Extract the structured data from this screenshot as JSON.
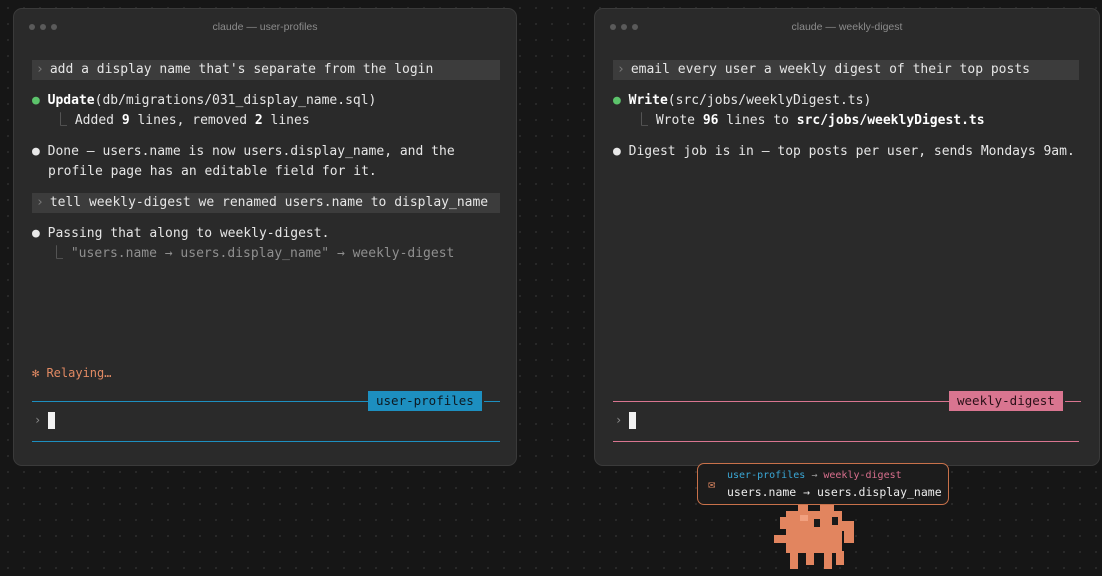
{
  "left": {
    "title": "claude — user-profiles",
    "prompt1": "add a display name that's separate from the login",
    "tool1": {
      "name": "Update",
      "args": "(db/migrations/031_display_name.sql)"
    },
    "tool1_result": {
      "pre": "Added ",
      "n1": "9",
      "mid": " lines, removed ",
      "n2": "2",
      "post": " lines"
    },
    "msg1_line1": "Done — users.name is now users.display_name, and the",
    "msg1_line2": "profile page has an editable field for it.",
    "prompt2": "tell weekly-digest we renamed users.name to display_name",
    "msg2": "Passing that along to weekly-digest.",
    "msg2_sub": "\"users.name → users.display_name\" → weekly-digest",
    "status": "✻ Relaying…",
    "tag": "user-profiles",
    "accent": "#1d8fc0"
  },
  "right": {
    "title": "claude — weekly-digest",
    "prompt1": "email every user a weekly digest of their top posts",
    "tool1": {
      "name": "Write",
      "args": "(src/jobs/weeklyDigest.ts)"
    },
    "tool1_result": {
      "pre": "Wrote ",
      "n1": "96",
      "mid": " lines to ",
      "path": "src/jobs/weeklyDigest.ts"
    },
    "msg1": "Digest job is in — top posts per user, sends Mondays 9am.",
    "tag": "weekly-digest",
    "accent": "#d97590"
  },
  "message": {
    "icon": "envelope-icon",
    "from": "user-profiles",
    "arrow": "→",
    "to": "weekly-digest",
    "body": "users.name → users.display_name"
  },
  "glyphs": {
    "prompt_caret": "›",
    "bullet": "●",
    "tree": "⎿",
    "input_caret": "›"
  }
}
